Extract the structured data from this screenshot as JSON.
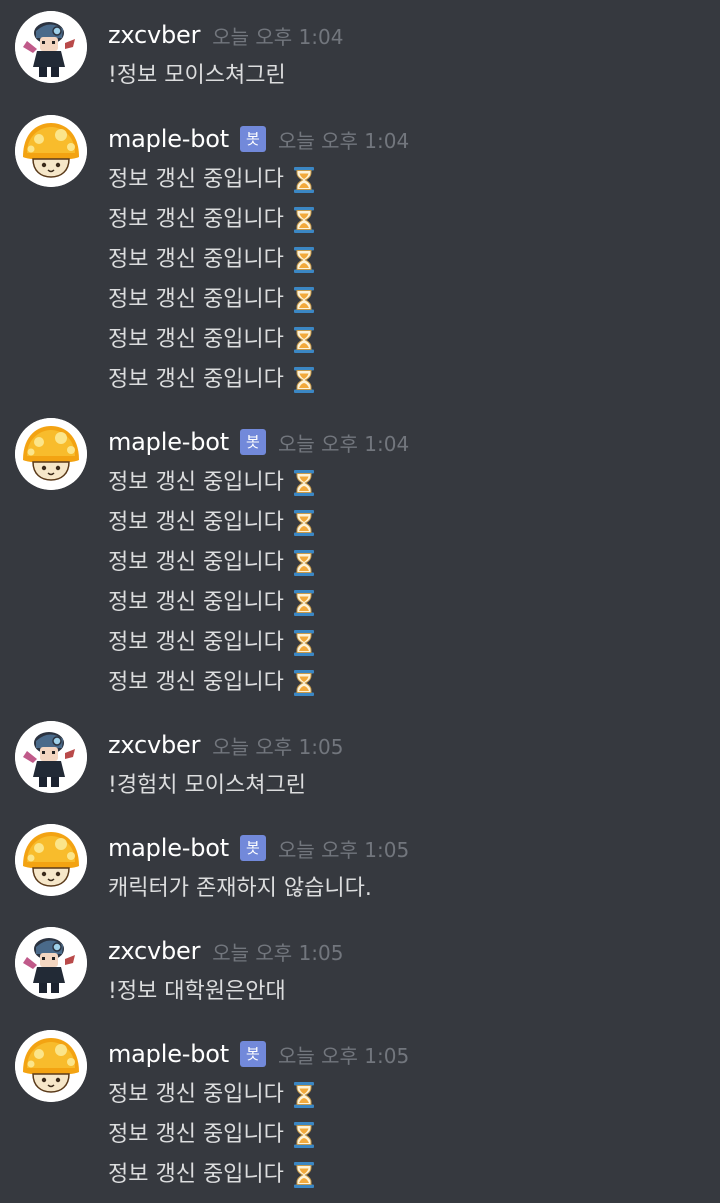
{
  "labels": {
    "bot_badge": "봇"
  },
  "colors": {
    "background": "#36393f",
    "username": "#ffffff",
    "timestamp": "#72767d",
    "text": "#dcddde",
    "bot_badge": "#7289da"
  },
  "messages": [
    {
      "author": "zxcvber",
      "avatar": "character-avatar",
      "bot": false,
      "time": "오늘 오후 1:04",
      "lines": [
        {
          "text": "!정보 모이스쳐그린",
          "icon": null
        }
      ]
    },
    {
      "author": "maple-bot",
      "avatar": "mushroom-avatar",
      "bot": true,
      "time": "오늘 오후 1:04",
      "lines": [
        {
          "text": "정보 갱신 중입니다",
          "icon": "hourglass-icon"
        },
        {
          "text": "정보 갱신 중입니다",
          "icon": "hourglass-icon"
        },
        {
          "text": "정보 갱신 중입니다",
          "icon": "hourglass-icon"
        },
        {
          "text": "정보 갱신 중입니다",
          "icon": "hourglass-icon"
        },
        {
          "text": "정보 갱신 중입니다",
          "icon": "hourglass-icon"
        },
        {
          "text": "정보 갱신 중입니다",
          "icon": "hourglass-icon"
        }
      ]
    },
    {
      "author": "maple-bot",
      "avatar": "mushroom-avatar",
      "bot": true,
      "time": "오늘 오후 1:04",
      "lines": [
        {
          "text": "정보 갱신 중입니다",
          "icon": "hourglass-icon"
        },
        {
          "text": "정보 갱신 중입니다",
          "icon": "hourglass-icon"
        },
        {
          "text": "정보 갱신 중입니다",
          "icon": "hourglass-icon"
        },
        {
          "text": "정보 갱신 중입니다",
          "icon": "hourglass-icon"
        },
        {
          "text": "정보 갱신 중입니다",
          "icon": "hourglass-icon"
        },
        {
          "text": "정보 갱신 중입니다",
          "icon": "hourglass-icon"
        }
      ]
    },
    {
      "author": "zxcvber",
      "avatar": "character-avatar",
      "bot": false,
      "time": "오늘 오후 1:05",
      "lines": [
        {
          "text": "!경험치 모이스쳐그린",
          "icon": null
        }
      ]
    },
    {
      "author": "maple-bot",
      "avatar": "mushroom-avatar",
      "bot": true,
      "time": "오늘 오후 1:05",
      "lines": [
        {
          "text": "캐릭터가 존재하지 않습니다.",
          "icon": null
        }
      ]
    },
    {
      "author": "zxcvber",
      "avatar": "character-avatar",
      "bot": false,
      "time": "오늘 오후 1:05",
      "lines": [
        {
          "text": "!정보 대학원은안대",
          "icon": null
        }
      ]
    },
    {
      "author": "maple-bot",
      "avatar": "mushroom-avatar",
      "bot": true,
      "time": "오늘 오후 1:05",
      "lines": [
        {
          "text": "정보 갱신 중입니다",
          "icon": "hourglass-icon"
        },
        {
          "text": "정보 갱신 중입니다",
          "icon": "hourglass-icon"
        },
        {
          "text": "정보 갱신 중입니다",
          "icon": "hourglass-icon"
        }
      ]
    }
  ]
}
